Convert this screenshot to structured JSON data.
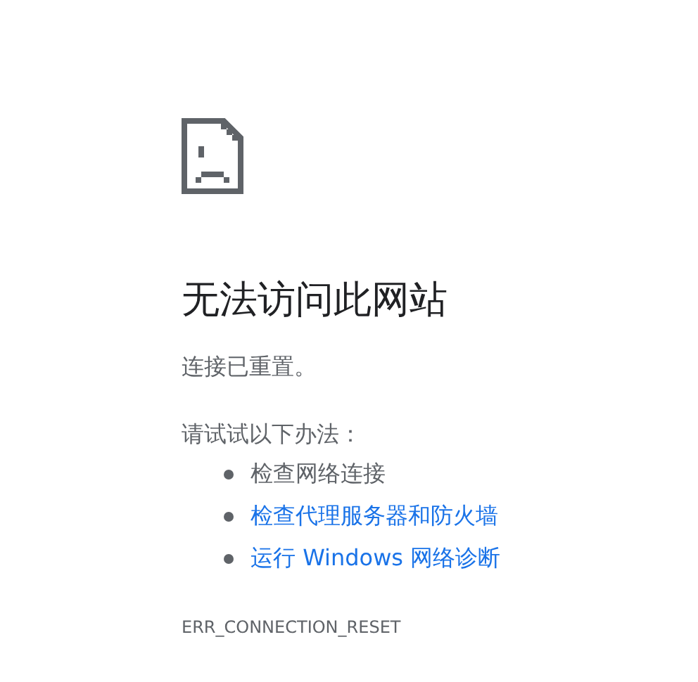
{
  "heading": "无法访问此网站",
  "message": "连接已重置。",
  "suggestions": {
    "intro": "请试试以下办法：",
    "items": [
      {
        "text": "检查网络连接",
        "kind": "text"
      },
      {
        "text": "检查代理服务器和防火墙",
        "kind": "link"
      },
      {
        "text": "运行 Windows 网络诊断",
        "kind": "link"
      }
    ]
  },
  "error_code": "ERR_CONNECTION_RESET"
}
